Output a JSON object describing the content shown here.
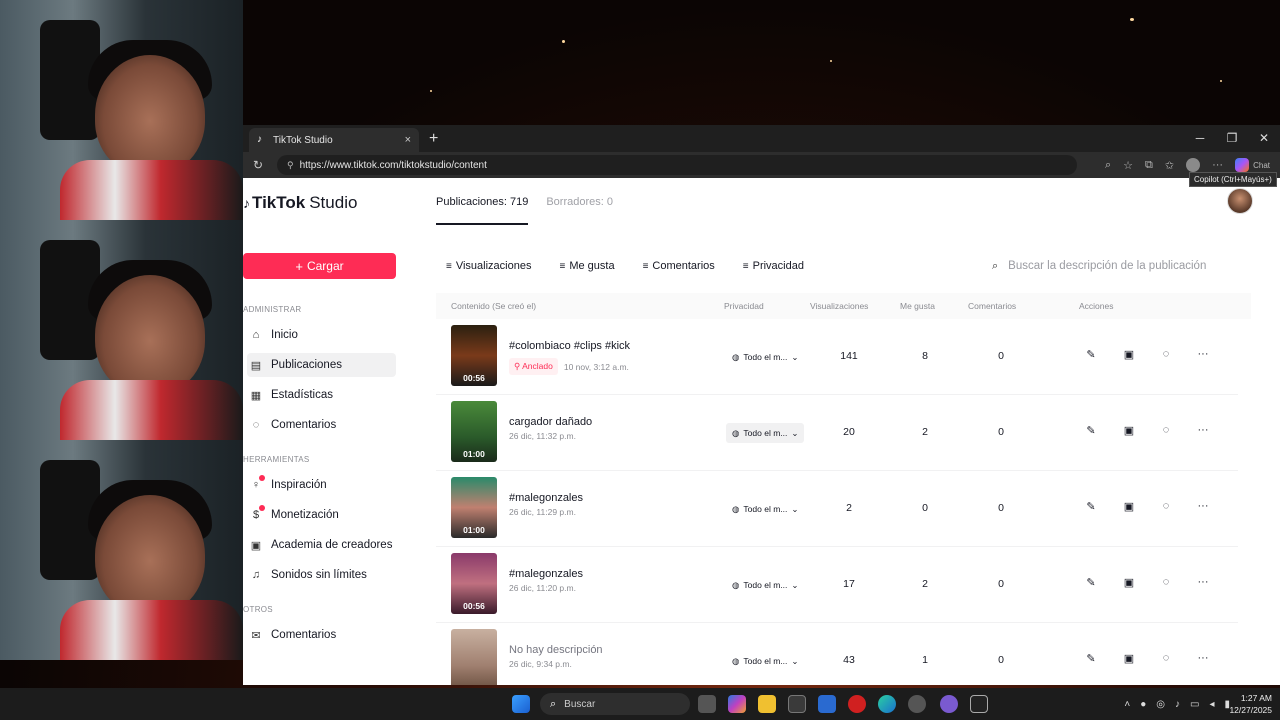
{
  "browser": {
    "tab_title": "TikTok Studio",
    "tab_close": "×",
    "new_tab": "+",
    "url": "https://www.tiktok.com/tiktokstudio/content",
    "window_controls": [
      "─",
      "❐",
      "✕"
    ],
    "copilot_tooltip": "Copilot (Ctrl+Mayús+)",
    "copilot_label": "Chat"
  },
  "sidebar": {
    "logo_main": "TikTok",
    "logo_sub": "Studio",
    "upload_label": "Cargar",
    "sections": {
      "administrar": "ADMINISTRAR",
      "herramientas": "HERRAMIENTAS",
      "otros": "OTROS"
    },
    "items": [
      {
        "label": "Inicio",
        "icon": "home-icon"
      },
      {
        "label": "Publicaciones",
        "icon": "posts-icon"
      },
      {
        "label": "Estadísticas",
        "icon": "stats-icon"
      },
      {
        "label": "Comentarios",
        "icon": "comment-icon"
      },
      {
        "label": "Inspiración",
        "icon": "bulb-icon"
      },
      {
        "label": "Monetización",
        "icon": "dollar-icon"
      },
      {
        "label": "Academia de creadores",
        "icon": "academy-icon"
      },
      {
        "label": "Sonidos sin límites",
        "icon": "music-icon"
      },
      {
        "label": "Comentarios",
        "icon": "feedback-icon"
      }
    ]
  },
  "main": {
    "tabs": [
      {
        "label": "Publicaciones: 719"
      },
      {
        "label": "Borradores: 0"
      }
    ],
    "filters": [
      {
        "label": "Visualizaciones"
      },
      {
        "label": "Me gusta"
      },
      {
        "label": "Comentarios"
      },
      {
        "label": "Privacidad"
      }
    ],
    "search_placeholder": "Buscar la descripción de la publicación",
    "columns": {
      "content": "Contenido (Se creó el)",
      "privacy": "Privacidad",
      "views": "Visualizaciones",
      "likes": "Me gusta",
      "comments": "Comentarios",
      "actions": "Acciones"
    },
    "rows": [
      {
        "title": "#colombiaco #clips #kick",
        "pinned": "Anclado",
        "date": "10 nov, 3:12 a.m.",
        "duration": "00:56",
        "privacy": "Todo el m...",
        "views": "141",
        "likes": "8",
        "comments": "0",
        "thumb_color": "#3a2a18"
      },
      {
        "title": "cargador dañado",
        "pinned": "",
        "date": "26 dic, 11:32 p.m.",
        "duration": "01:00",
        "privacy": "Todo el m...",
        "views": "20",
        "likes": "2",
        "comments": "0",
        "thumb_color": "#3f7a3a"
      },
      {
        "title": "#malegonzales",
        "pinned": "",
        "date": "26 dic, 11:29 p.m.",
        "duration": "01:00",
        "privacy": "Todo el m...",
        "views": "2",
        "likes": "0",
        "comments": "0",
        "thumb_color": "#1f6b5a"
      },
      {
        "title": "#malegonzales",
        "pinned": "",
        "date": "26 dic, 11:20 p.m.",
        "duration": "00:56",
        "privacy": "Todo el m...",
        "views": "17",
        "likes": "2",
        "comments": "0",
        "thumb_color": "#7a2a4a"
      },
      {
        "title": "No hay descripción",
        "pinned": "",
        "date": "26 dic, 9:34 p.m.",
        "duration": "",
        "privacy": "Todo el m...",
        "views": "43",
        "likes": "1",
        "comments": "0",
        "thumb_color": "#b89a8a"
      }
    ]
  },
  "taskbar": {
    "search_label": "Buscar",
    "time": "1:27 AM",
    "date": "12/27/2025"
  }
}
